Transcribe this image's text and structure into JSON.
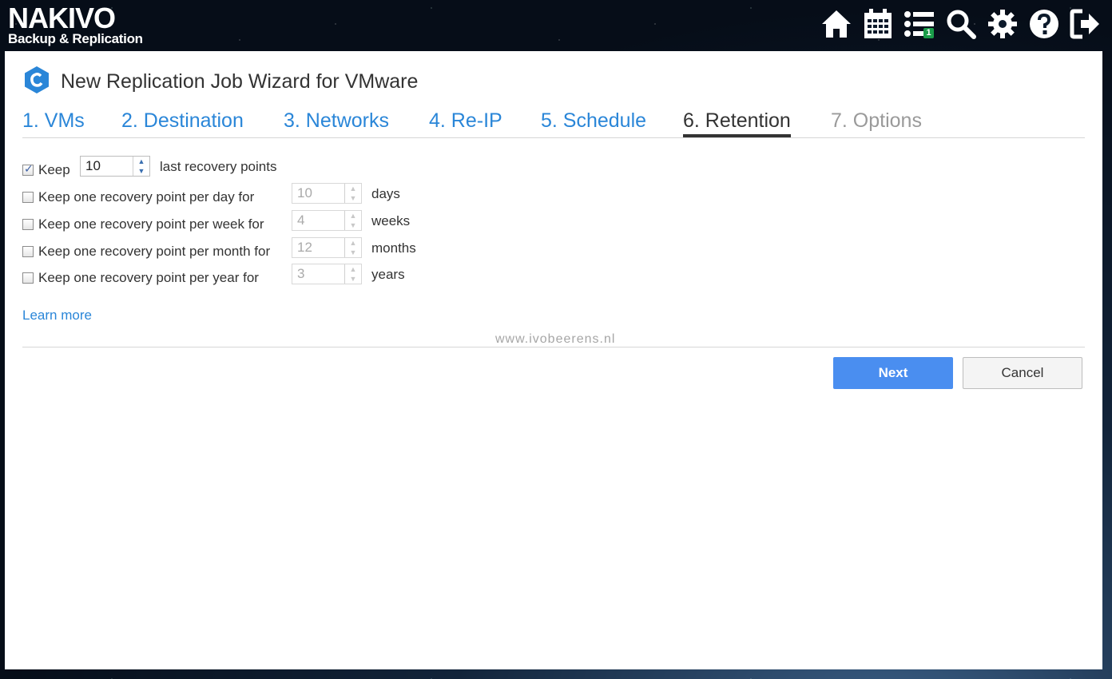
{
  "app": {
    "brand": "NAKIVO",
    "subtitle": "Backup & Replication"
  },
  "toolbar": {
    "icons": [
      "home-icon",
      "calendar-icon",
      "tasks-icon",
      "search-icon",
      "gear-icon",
      "help-icon",
      "logout-icon"
    ],
    "tasks_badge": "1"
  },
  "wizard": {
    "title": "New Replication Job Wizard for VMware",
    "tabs": [
      {
        "label": "1. VMs",
        "state": "link"
      },
      {
        "label": "2. Destination",
        "state": "link"
      },
      {
        "label": "3. Networks",
        "state": "link"
      },
      {
        "label": "4. Re-IP",
        "state": "link"
      },
      {
        "label": "5. Schedule",
        "state": "link"
      },
      {
        "label": "6. Retention",
        "state": "active"
      },
      {
        "label": "7. Options",
        "state": "disabled"
      }
    ]
  },
  "retention": {
    "keep_last": {
      "label": "Keep",
      "value": "10",
      "unit": "last recovery points",
      "checked": true
    },
    "rows": [
      {
        "label": "Keep one recovery point per day for",
        "value": "10",
        "unit": "days",
        "checked": false
      },
      {
        "label": "Keep one recovery point per week for",
        "value": "4",
        "unit": "weeks",
        "checked": false
      },
      {
        "label": "Keep one recovery point per month for",
        "value": "12",
        "unit": "months",
        "checked": false
      },
      {
        "label": "Keep one recovery point per year for",
        "value": "3",
        "unit": "years",
        "checked": false
      }
    ],
    "learn_more": "Learn more"
  },
  "watermark": "www.ivobeerens.nl",
  "buttons": {
    "next": "Next",
    "cancel": "Cancel"
  },
  "colors": {
    "accent": "#2a86d8",
    "primary_button": "#4a8ef0",
    "badge": "#1a9c49"
  }
}
